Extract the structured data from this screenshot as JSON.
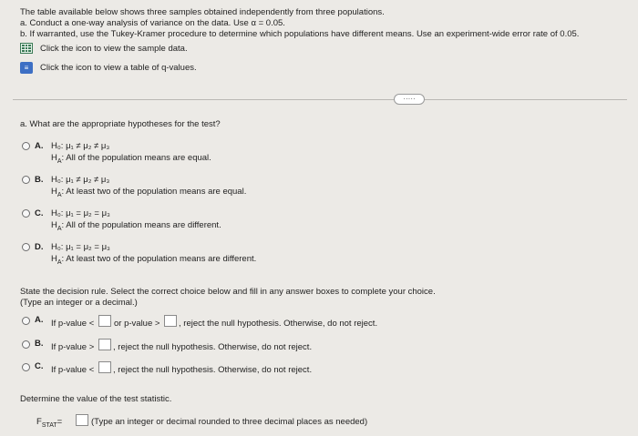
{
  "intro": {
    "line1": "The table available below shows three samples obtained independently from three populations.",
    "line2": "a. Conduct a one-way analysis of variance on the data. Use α = 0.05.",
    "line3": "b. If warranted, use the Tukey-Kramer procedure to determine which populations have different means. Use an experiment-wide error rate of 0.05.",
    "sample_link": "Click the icon to view the sample data.",
    "qvalue_link": "Click the icon to view a table of q-values."
  },
  "more_button": "·····",
  "question_a": {
    "prompt": "a. What are the appropriate hypotheses for the test?",
    "options": [
      {
        "letter": "A.",
        "h0": "H₀: μ₁ ≠ μ₂ ≠ μ₃",
        "ha": "H",
        "ha_sub": "A",
        "ha_text": ": All of the population means are equal."
      },
      {
        "letter": "B.",
        "h0": "H₀: μ₁ ≠ μ₂ ≠ μ₃",
        "ha": "H",
        "ha_sub": "A",
        "ha_text": ": At least two of the population means are equal."
      },
      {
        "letter": "C.",
        "h0": "H₀: μ₁ = μ₂ = μ₃",
        "ha": "H",
        "ha_sub": "A",
        "ha_text": ": All of the population means are different."
      },
      {
        "letter": "D.",
        "h0": "H₀: μ₁ = μ₂ = μ₃",
        "ha": "H",
        "ha_sub": "A",
        "ha_text": ": At least two of the population means are different."
      }
    ]
  },
  "decision": {
    "prompt1": "State the decision rule. Select the correct choice below and fill in any answer boxes to complete your choice.",
    "prompt2": "(Type an integer or a decimal.)",
    "options": [
      {
        "letter": "A.",
        "pre": "If p-value <",
        "mid": "or p-value >",
        "post": ", reject the null hypothesis. Otherwise, do not reject."
      },
      {
        "letter": "B.",
        "pre": "If p-value >",
        "post": ", reject the null hypothesis. Otherwise, do not reject."
      },
      {
        "letter": "C.",
        "pre": "If p-value <",
        "post": ", reject the null hypothesis. Otherwise, do not reject."
      }
    ]
  },
  "statistic": {
    "prompt": "Determine the value of the test statistic.",
    "label": "F",
    "label_sub": "STAT",
    "equals": "=",
    "hint": "(Type an integer or decimal rounded to three decimal places as needed)"
  },
  "colors": {
    "grid_icon": "#3a7a55",
    "book_icon": "#3d6fc4"
  },
  "icons": {
    "sample": "table-grid-icon",
    "qvalues": "book-icon"
  }
}
